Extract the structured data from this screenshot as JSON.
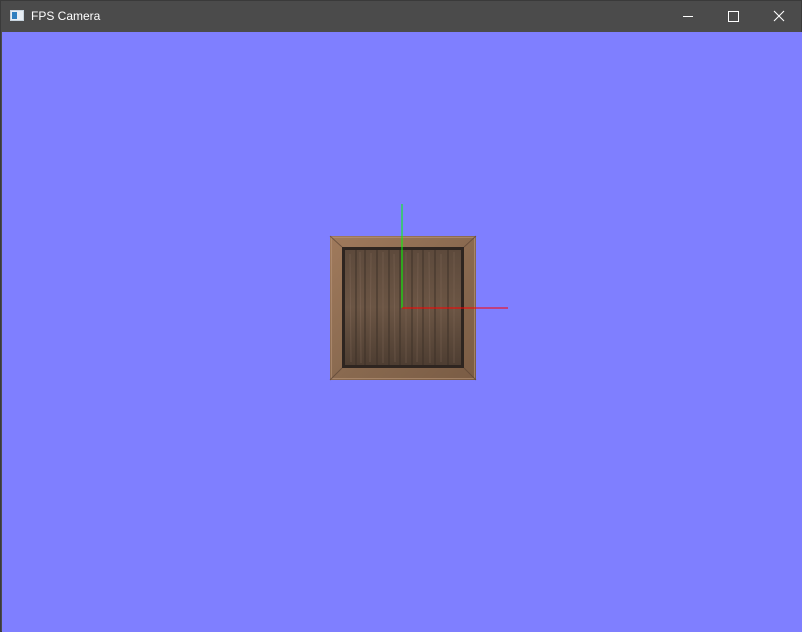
{
  "window": {
    "title": "FPS Camera",
    "controls": {
      "minimize": "minimize",
      "maximize": "maximize",
      "close": "close"
    }
  },
  "scene": {
    "clear_color": "#7f7fff",
    "object": "wooden-crate",
    "axes": {
      "x_color": "#ff0000",
      "y_color": "#00ff00"
    }
  }
}
